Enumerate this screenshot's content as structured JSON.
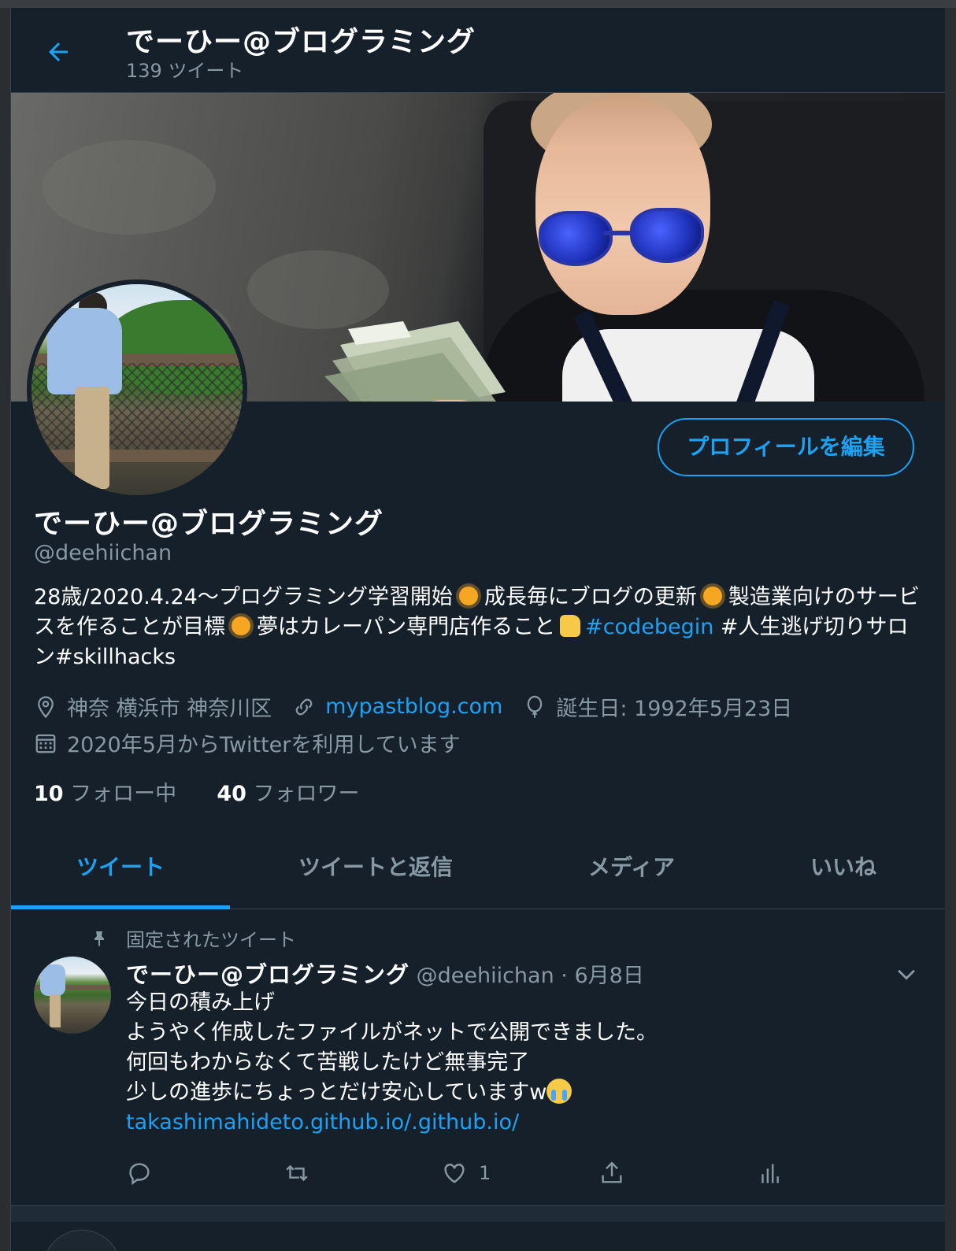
{
  "header": {
    "title": "でーひー@ブログラミング",
    "tweet_count": "139 ツイート"
  },
  "profile": {
    "name": "でーひー@ブログラミング",
    "handle": "@deehiichan",
    "edit_button": "プロフィールを編集",
    "bio": {
      "part1": "28歳/2020.4.24〜プログラミング学習開始",
      "part2": "成長毎にブログの更新",
      "part3": "製造業向けのサービスを作ることが目標",
      "part4": "夢はカレーパン専門店作ること",
      "hashtag1": "#codebegin",
      "part5": " #人生逃げ切りサロン#skillhacks"
    },
    "location": "神奈 横浜市 神奈川区",
    "website": "mypastblog.com",
    "birthday": "誕生日: 1992年5月23日",
    "joined": "2020年5月からTwitterを利用しています",
    "following_count": "10",
    "following_label": "フォロー中",
    "followers_count": "40",
    "followers_label": "フォロワー"
  },
  "tabs": [
    {
      "label": "ツイート",
      "active": true
    },
    {
      "label": "ツイートと返信",
      "active": false
    },
    {
      "label": "メディア",
      "active": false
    },
    {
      "label": "いいね",
      "active": false
    }
  ],
  "tweet": {
    "pinned_label": "固定されたツイート",
    "author_name": "でーひー@ブログラミング",
    "author_handle": "@deehiichan",
    "date": "6月8日",
    "lines": [
      "今日の積み上げ",
      "ようやく作成したファイルがネットで公開できました。",
      "何回もわからなくて苦戦したけど無事完了",
      "少しの進歩にちょっとだけ安心していますw"
    ],
    "link": "takashimahideto.github.io/.github.io/",
    "like_count": "1"
  },
  "colors": {
    "background": "#15202b",
    "accent": "#1da1f2",
    "muted_text": "#8899a6",
    "border": "#38444d"
  },
  "icons": [
    "back-arrow-icon",
    "location-pin-icon",
    "link-icon",
    "balloon-icon",
    "calendar-icon",
    "pin-icon",
    "chevron-down-icon",
    "reply-icon",
    "retweet-icon",
    "like-icon",
    "share-icon",
    "analytics-icon",
    "sun-emoji",
    "thumbs-up-emoji",
    "crying-emoji"
  ]
}
